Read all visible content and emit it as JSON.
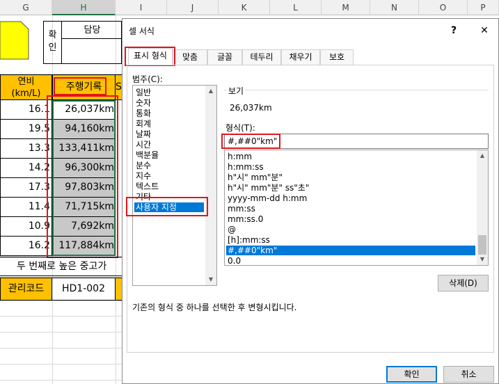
{
  "sheet": {
    "columns": [
      "G",
      "H",
      "I",
      "J",
      "K",
      "L",
      "M",
      "N",
      "O",
      "P"
    ],
    "approval": {
      "confirm": "확\n인",
      "manager": "담당"
    },
    "headers": {
      "g": "연비\n(km/L)",
      "h": "주행기록",
      "i": "S"
    },
    "rows": [
      {
        "g": "16.1",
        "h": "26,037km"
      },
      {
        "g": "19.5",
        "h": "94,160km"
      },
      {
        "g": "13.3",
        "h": "133,411km"
      },
      {
        "g": "14.2",
        "h": "96,300km"
      },
      {
        "g": "17.3",
        "h": "97,803km"
      },
      {
        "g": "11.4",
        "h": "71,715km"
      },
      {
        "g": "10.9",
        "h": "7,692km"
      },
      {
        "g": "16.2",
        "h": "117,884km"
      }
    ],
    "merged_text": "두 번째로 높은 중고가",
    "code_label": "관리코드",
    "code_value": "HD1-002"
  },
  "dialog": {
    "title": "셀 서식",
    "help": "?",
    "close": "✕",
    "tabs": [
      "표시 형식",
      "맞춤",
      "글꼴",
      "테두리",
      "채우기",
      "보호"
    ],
    "category_label": "범주(C):",
    "categories": [
      "일반",
      "숫자",
      "통화",
      "회계",
      "날짜",
      "시간",
      "백분율",
      "분수",
      "지수",
      "텍스트",
      "기타",
      "사용자 지정"
    ],
    "selected_category": "사용자 지정",
    "sample_label": "보기",
    "sample_value": "26,037km",
    "format_label": "형식(T):",
    "format_value": "#,##0\"km\"",
    "formats": [
      "h:mm",
      "h:mm:ss",
      "h\"시\" mm\"분\"",
      "h\"시\" mm\"분\" ss\"초\"",
      "yyyy-mm-dd h:mm",
      "mm:ss",
      "mm:ss.0",
      "@",
      "[h]:mm:ss",
      "#,##0\"km\"",
      "0.0_"
    ],
    "selected_format": "#,##0\"km\"",
    "delete_button": "삭제(D)",
    "description": "기존의 형식 중 하나를 선택한 후 변형시킵니다.",
    "ok_button": "확인",
    "cancel_button": "취소"
  },
  "colors": {
    "accent": "#0078d7",
    "highlight": "#e0141e",
    "yellow": "#ffff00",
    "orange": "#ffc000",
    "selected_column": "#217346"
  }
}
